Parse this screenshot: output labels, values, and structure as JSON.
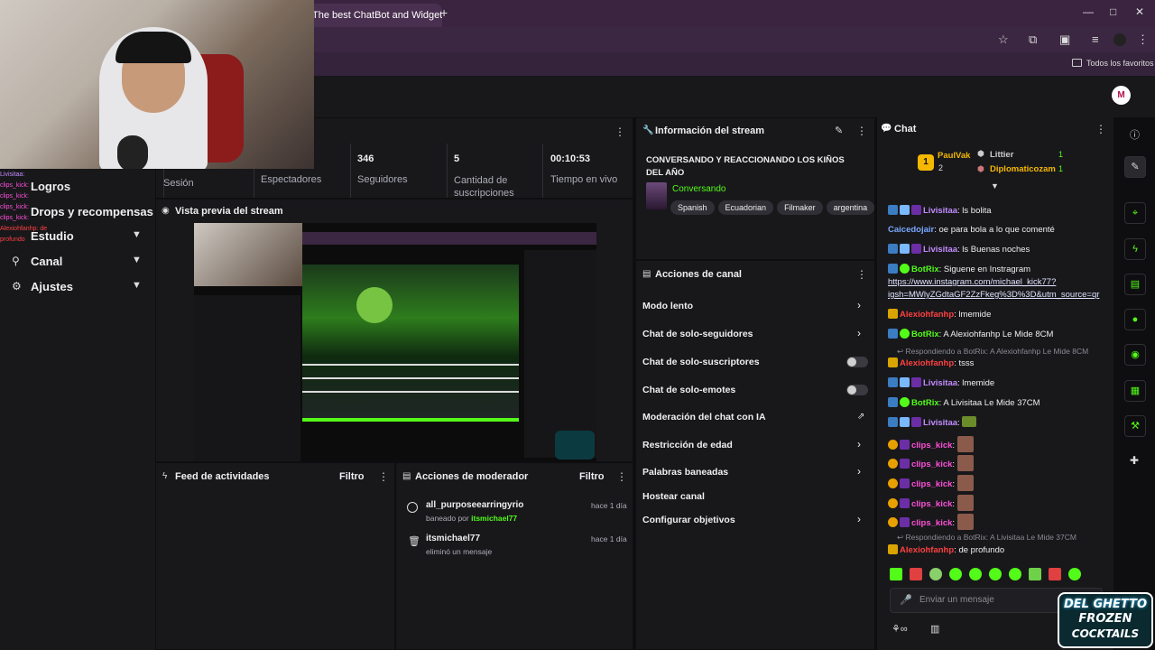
{
  "browser": {
    "tab_title": "The best ChatBot and Widgets",
    "new_tab": "+",
    "bookmarks_label": "Todos los favoritos",
    "profile_initial": "M"
  },
  "sidebar": {
    "overlay_lines": [
      "Livisitaa:",
      "clips_kick:",
      "clips_kick:",
      "clips_kick:",
      "clips_kick:",
      "Alexiohfanhp: de profundo"
    ],
    "items": [
      {
        "label": "Logros"
      },
      {
        "label": "Drops y recompensas"
      },
      {
        "label": "Estudio"
      },
      {
        "label": "Canal"
      },
      {
        "label": "Ajustes"
      }
    ]
  },
  "stats": {
    "session_label": "Sesión",
    "viewers_label": "Espectadores",
    "followers_value": "346",
    "followers_label": "Seguidores",
    "subs_value": "5",
    "subs_label": "Cantidad de suscripciones",
    "live_value": "00:10:53",
    "live_label": "Tiempo en vivo"
  },
  "preview": {
    "title": "Vista previa del stream"
  },
  "feed": {
    "title": "Feed de actividades",
    "filter": "Filtro"
  },
  "mod_actions": {
    "title": "Acciones de moderador",
    "filter": "Filtro",
    "items": [
      {
        "user": "all_purposeearringyrio",
        "action": "baneado por",
        "by": "itsmichael77",
        "time": "hace 1 día"
      },
      {
        "user": "itsmichael77",
        "action": "eliminó un mensaje",
        "by": "",
        "time": "hace 1 día"
      }
    ]
  },
  "stream_info": {
    "title": "Información del stream",
    "stream_title": "CONVERSANDO Y REACCIONANDO LOS KIÑOS DEL AÑO",
    "category": "Conversando",
    "tags": [
      "Spanish",
      "Ecuadorian",
      "Filmaker",
      "argentina"
    ]
  },
  "channel_actions": {
    "title": "Acciones de canal",
    "items": [
      {
        "label": "Modo lento",
        "kind": "arrow"
      },
      {
        "label": "Chat de solo-seguidores",
        "kind": "arrow"
      },
      {
        "label": "Chat de solo-suscriptores",
        "kind": "toggle"
      },
      {
        "label": "Chat de solo-emotes",
        "kind": "toggle"
      },
      {
        "label": "Moderación del chat con IA",
        "kind": "external"
      },
      {
        "label": "Restricción de edad",
        "kind": "arrow"
      },
      {
        "label": "Palabras baneadas",
        "kind": "arrow"
      },
      {
        "label": "Hostear canal",
        "kind": "none"
      },
      {
        "label": "Configurar objetivos",
        "kind": "arrow"
      }
    ]
  },
  "chat": {
    "title": "Chat",
    "leaderboard": {
      "first": "PaulVak",
      "first_count": "2",
      "second": "Littier",
      "second_count": "1",
      "third": "Diplomaticozam",
      "third_count": "1"
    },
    "messages": [
      {
        "user": "Livisitaa",
        "text": ": ls bolita",
        "color": "purple"
      },
      {
        "user": "Caicedojair",
        "text": ": oe para bola a lo que comenté",
        "color": "blue"
      },
      {
        "user": "Livisitaa",
        "text": ": ls Buenas noches",
        "color": "purple"
      },
      {
        "user": "BotRix",
        "text": ": Siguene en Instragram",
        "color": "green"
      },
      {
        "user": "",
        "text": "https://www.instagram.com/michael_kick77?",
        "color": "link"
      },
      {
        "user": "",
        "text": "igsh=MWlyZGdtaGF2ZzFkeg%3D%3D&utm_source=qr",
        "color": "link"
      },
      {
        "user": "Alexiohfanhp",
        "text": ": lmemide",
        "color": "red"
      },
      {
        "user": "BotRix",
        "text": ": A Alexiohfanhp Le Mide 8CM",
        "color": "green"
      },
      {
        "user": "reply",
        "text": "Respondiendo a BotRix: A Alexiohfanhp Le Mide 8CM",
        "color": "reply"
      },
      {
        "user": "Alexiohfanhp",
        "text": ": tsss",
        "color": "red"
      },
      {
        "user": "Livisitaa",
        "text": ": lmemide",
        "color": "purple"
      },
      {
        "user": "BotRix",
        "text": ": A Livisitaa Le Mide 37CM",
        "color": "green"
      },
      {
        "user": "Livisitaa",
        "text": ":",
        "color": "purple"
      },
      {
        "user": "clips_kick",
        "text": ":",
        "color": "pink"
      },
      {
        "user": "clips_kick",
        "text": ":",
        "color": "pink"
      },
      {
        "user": "clips_kick",
        "text": ":",
        "color": "pink"
      },
      {
        "user": "clips_kick",
        "text": ":",
        "color": "pink"
      },
      {
        "user": "clips_kick",
        "text": ":",
        "color": "pink"
      },
      {
        "user": "reply",
        "text": "Respondiendo a BotRix: A Livisitaa Le Mide 37CM",
        "color": "reply"
      },
      {
        "user": "Alexiohfanhp",
        "text": ": de profundo",
        "color": "red"
      }
    ],
    "input_placeholder": "Enviar un mensaje"
  },
  "watermark": {
    "line1": "DEL GHETTO",
    "line2": "FROZEN",
    "line3": "COCKTAILS"
  }
}
